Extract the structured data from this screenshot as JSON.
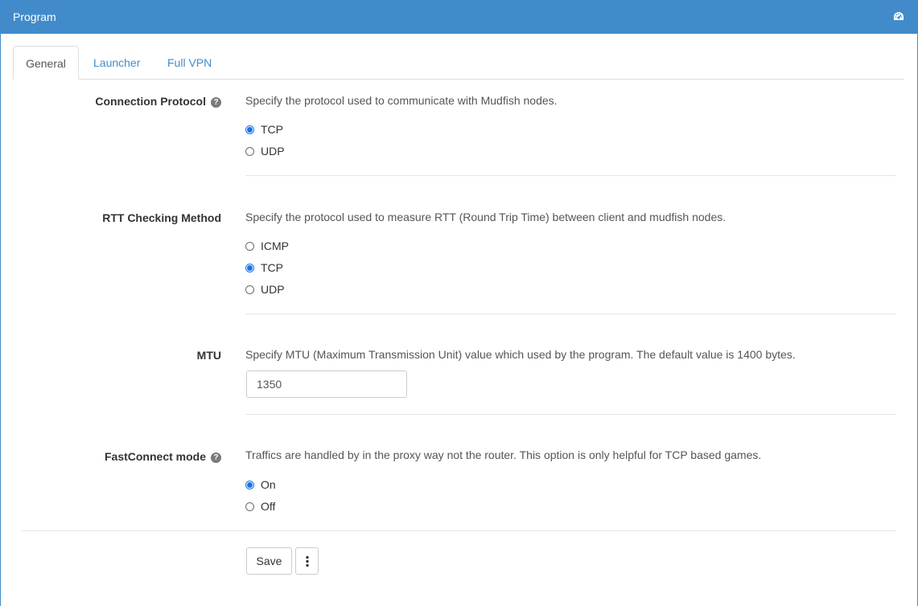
{
  "header": {
    "title": "Program",
    "icon": "dashboard-icon",
    "bg_color": "#428bca"
  },
  "tabs": [
    {
      "label": "General",
      "active": true
    },
    {
      "label": "Launcher",
      "active": false
    },
    {
      "label": "Full VPN",
      "active": false
    }
  ],
  "sections": {
    "connection_protocol": {
      "label": "Connection Protocol",
      "has_help": true,
      "description": "Specify the protocol used to communicate with Mudfish nodes.",
      "options": [
        {
          "label": "TCP",
          "checked": true
        },
        {
          "label": "UDP",
          "checked": false
        }
      ]
    },
    "rtt_method": {
      "label": "RTT Checking Method",
      "description": "Specify the protocol used to measure RTT (Round Trip Time) between client and mudfish nodes.",
      "options": [
        {
          "label": "ICMP",
          "checked": false
        },
        {
          "label": "TCP",
          "checked": true
        },
        {
          "label": "UDP",
          "checked": false
        }
      ]
    },
    "mtu": {
      "label": "MTU",
      "description": "Specify MTU (Maximum Transmission Unit) value which used by the program. The default value is 1400 bytes.",
      "value": "1350"
    },
    "fastconnect": {
      "label": "FastConnect mode",
      "has_help": true,
      "description": "Traffics are handled by in the proxy way not the router. This option is only helpful for TCP based games.",
      "options": [
        {
          "label": "On",
          "checked": true
        },
        {
          "label": "Off",
          "checked": false
        }
      ]
    }
  },
  "actions": {
    "save_label": "Save",
    "more_icon": "vertical-ellipsis-icon"
  },
  "help_glyph": "?",
  "accent_color": "#1a73e8"
}
